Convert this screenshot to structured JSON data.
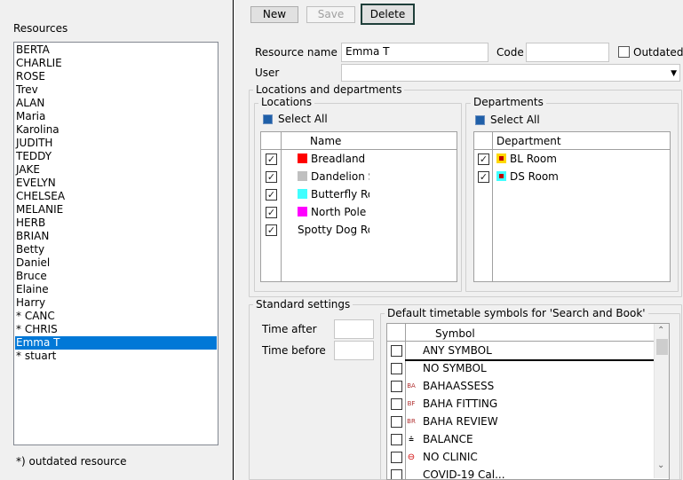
{
  "left_panel": {
    "title": "Resources",
    "items": [
      "BERTA",
      "CHARLIE",
      "ROSE",
      "Trev",
      "ALAN",
      "Maria",
      "Karolina",
      "JUDITH",
      "TEDDY",
      "JAKE",
      "EVELYN",
      "CHELSEA",
      "MELANIE",
      "HERB",
      "BRIAN",
      "Betty",
      "Daniel",
      "Bruce",
      "Elaine",
      "Harry",
      "* CANC",
      "* CHRIS",
      "Emma T",
      "* stuart"
    ],
    "selected_item": "Emma T",
    "footnote": "*) outdated resource"
  },
  "toolbar": {
    "new_label": "New",
    "save_label": "Save",
    "delete_label": "Delete"
  },
  "form": {
    "resource_name_label": "Resource name",
    "resource_name_value": "Emma T",
    "code_label": "Code",
    "code_value": "",
    "outdated_label": "Outdated",
    "user_label": "User",
    "user_value": ""
  },
  "locations_departments": {
    "group_title": "Locations and departments",
    "locations": {
      "title": "Locations",
      "select_all_label": "Select All",
      "column_header": "Name",
      "rows": [
        {
          "name": "Breadland",
          "color": "#ff0000",
          "checked": true
        },
        {
          "name": "Dandelion S",
          "color": "#c0c0c0",
          "checked": true
        },
        {
          "name": "Butterfly Roa",
          "color": "#40ffff",
          "checked": true
        },
        {
          "name": "North Pole",
          "color": "#ff00ff",
          "checked": true
        },
        {
          "name": "Spotty Dog Roa",
          "color": "",
          "checked": true
        }
      ]
    },
    "departments": {
      "title": "Departments",
      "select_all_label": "Select All",
      "column_header": "Department",
      "rows": [
        {
          "name": "BL Room",
          "color": "#ffd800",
          "checked": true
        },
        {
          "name": "DS Room",
          "color": "#40ffff",
          "checked": true
        }
      ]
    }
  },
  "standard_settings": {
    "group_title": "Standard settings",
    "time_after_label": "Time after",
    "time_after_value": "",
    "time_before_label": "Time before",
    "time_before_value": "",
    "symbols": {
      "title": "Default timetable symbols for 'Search and Book'",
      "column_header": "Symbol",
      "rows": [
        {
          "label": "ANY SYMBOL",
          "icon": "",
          "checked": false
        },
        {
          "label": "NO SYMBOL",
          "icon": "",
          "checked": false
        },
        {
          "label": "BAHAASSESS",
          "icon": "BA",
          "checked": false
        },
        {
          "label": "BAHA FITTING",
          "icon": "BF",
          "checked": false
        },
        {
          "label": "BAHA REVIEW",
          "icon": "BR",
          "checked": false
        },
        {
          "label": "BALANCE",
          "icon": "balance-icon",
          "checked": false
        },
        {
          "label": "NO CLINIC",
          "icon": "no-entry-icon",
          "checked": false
        },
        {
          "label": "COVID-19 Cal...",
          "icon": "",
          "checked": false
        }
      ]
    }
  },
  "colors": {
    "selection": "#0078d7",
    "select_all_square": "#1f5fa8"
  }
}
